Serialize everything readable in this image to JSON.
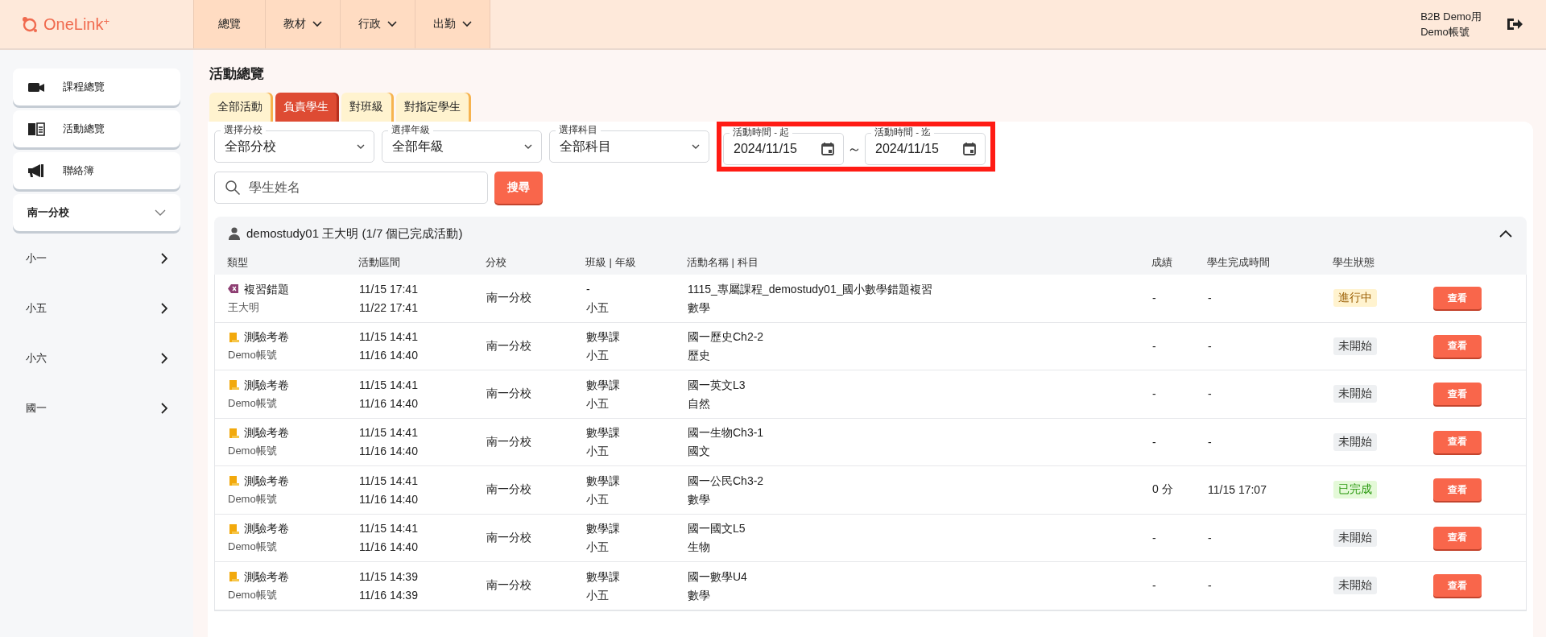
{
  "header": {
    "logo": "OneLink",
    "logo_sup": "+",
    "nav": [
      {
        "label": "總覽",
        "has_menu": false
      },
      {
        "label": "教材",
        "has_menu": true
      },
      {
        "label": "行政",
        "has_menu": true
      },
      {
        "label": "出勤",
        "has_menu": true
      }
    ],
    "user_lines": [
      "B2B Demo用",
      "Demo帳號"
    ]
  },
  "sidebar": {
    "cards": [
      {
        "label": "課程總覽",
        "kind": "video"
      },
      {
        "label": "活動總覽",
        "kind": "book"
      },
      {
        "label": "聯絡簿",
        "kind": "megaphone"
      }
    ],
    "school": {
      "label": "南一分校",
      "expanded": true
    },
    "grades": [
      "小一",
      "小五",
      "小六",
      "國一"
    ]
  },
  "page_title": "活動總覽",
  "tabs": [
    {
      "label": "全部活動",
      "selected": false
    },
    {
      "label": "負責學生",
      "selected": true
    },
    {
      "label": "對班級",
      "selected": false
    },
    {
      "label": "對指定學生",
      "selected": false
    }
  ],
  "filters": {
    "selects": [
      {
        "label": "選擇分校",
        "value": "全部分校"
      },
      {
        "label": "選擇年級",
        "value": "全部年級"
      },
      {
        "label": "選擇科目",
        "value": "全部科目"
      }
    ],
    "date_range": {
      "highlighted": true,
      "start": {
        "label": "活動時間 - 起",
        "value": "2024/11/15"
      },
      "separator": "～",
      "end": {
        "label": "活動時間 - 迄",
        "value": "2024/11/15"
      }
    },
    "search": {
      "placeholder": "學生姓名"
    },
    "search_button": "搜尋"
  },
  "student_group": {
    "title": "demostudy01 王大明 (1/7 個已完成活動)",
    "expanded": true,
    "columns": [
      "類型",
      "活動區間",
      "分校",
      "班級 | 年級",
      "活動名稱 | 科目",
      "成績",
      "學生完成時間",
      "學生狀態"
    ],
    "rows": [
      {
        "type": {
          "kind": "review",
          "label": "複習錯題"
        },
        "owner": "王大明",
        "start": "11/15 17:41",
        "end": "11/22 17:41",
        "branch": "南一分校",
        "class": "-",
        "grade": "小五",
        "activity": "1115_專屬課程_demostudy01_國小數學錯題複習",
        "subject": "數學",
        "score": "-",
        "completed_at": "-",
        "status": {
          "kind": "in_progress",
          "label": "進行中"
        },
        "action": "查看"
      },
      {
        "type": {
          "kind": "exam",
          "label": "測驗考卷"
        },
        "owner": "Demo帳號",
        "start": "11/15 14:41",
        "end": "11/16 14:40",
        "branch": "南一分校",
        "class": "數學課",
        "grade": "小五",
        "activity": "國一歷史Ch2-2",
        "subject": "歷史",
        "score": "-",
        "completed_at": "-",
        "status": {
          "kind": "not_started",
          "label": "未開始"
        },
        "action": "查看"
      },
      {
        "type": {
          "kind": "exam",
          "label": "測驗考卷"
        },
        "owner": "Demo帳號",
        "start": "11/15 14:41",
        "end": "11/16 14:40",
        "branch": "南一分校",
        "class": "數學課",
        "grade": "小五",
        "activity": "國一英文L3",
        "subject": "自然",
        "score": "-",
        "completed_at": "-",
        "status": {
          "kind": "not_started",
          "label": "未開始"
        },
        "action": "查看"
      },
      {
        "type": {
          "kind": "exam",
          "label": "測驗考卷"
        },
        "owner": "Demo帳號",
        "start": "11/15 14:41",
        "end": "11/16 14:40",
        "branch": "南一分校",
        "class": "數學課",
        "grade": "小五",
        "activity": "國一生物Ch3-1",
        "subject": "國文",
        "score": "-",
        "completed_at": "-",
        "status": {
          "kind": "not_started",
          "label": "未開始"
        },
        "action": "查看"
      },
      {
        "type": {
          "kind": "exam",
          "label": "測驗考卷"
        },
        "owner": "Demo帳號",
        "start": "11/15 14:41",
        "end": "11/16 14:40",
        "branch": "南一分校",
        "class": "數學課",
        "grade": "小五",
        "activity": "國一公民Ch3-2",
        "subject": "數學",
        "score": "0 分",
        "completed_at": "11/15 17:07",
        "status": {
          "kind": "done",
          "label": "已完成"
        },
        "action": "查看"
      },
      {
        "type": {
          "kind": "exam",
          "label": "測驗考卷"
        },
        "owner": "Demo帳號",
        "start": "11/15 14:41",
        "end": "11/16 14:40",
        "branch": "南一分校",
        "class": "數學課",
        "grade": "小五",
        "activity": "國一國文L5",
        "subject": "生物",
        "score": "-",
        "completed_at": "-",
        "status": {
          "kind": "not_started",
          "label": "未開始"
        },
        "action": "查看"
      },
      {
        "type": {
          "kind": "exam",
          "label": "測驗考卷"
        },
        "owner": "Demo帳號",
        "start": "11/15 14:39",
        "end": "11/16 14:39",
        "branch": "南一分校",
        "class": "數學課",
        "grade": "小五",
        "activity": "國一數學U4",
        "subject": "數學",
        "score": "-",
        "completed_at": "-",
        "status": {
          "kind": "not_started",
          "label": "未開始"
        },
        "action": "查看"
      }
    ]
  }
}
